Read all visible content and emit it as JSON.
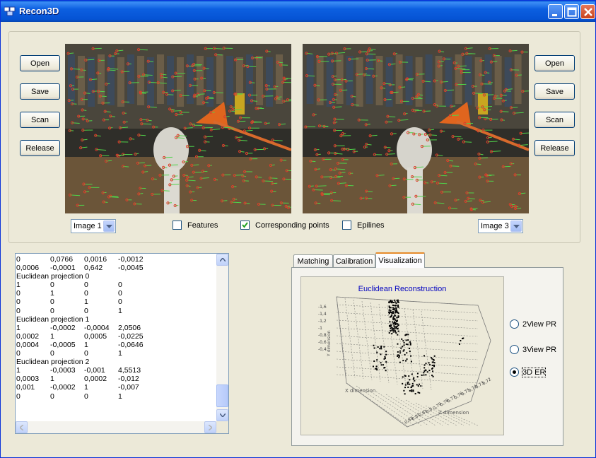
{
  "window": {
    "title": "Recon3D"
  },
  "left_buttons": [
    "Open",
    "Save",
    "Scan",
    "Release"
  ],
  "right_buttons": [
    "Open",
    "Save",
    "Scan",
    "Release"
  ],
  "left_image": {
    "alt": "Image 1",
    "selected": "Image 1"
  },
  "right_image": {
    "alt": "Image 3",
    "selected": "Image 3"
  },
  "checkboxes": [
    {
      "label": "Features",
      "checked": false
    },
    {
      "label": "Corresponding points",
      "checked": true
    },
    {
      "label": "Epilines",
      "checked": false
    }
  ],
  "output_lines": [
    [
      "0",
      "0,0766",
      "0,0016",
      "-0,0012"
    ],
    [
      "0,0006",
      "-0,0001",
      "0,642",
      "-0,0045"
    ],
    [
      "Euclidean projection 0"
    ],
    [
      "1",
      "0",
      "0",
      "0"
    ],
    [
      "0",
      "1",
      "0",
      "0"
    ],
    [
      "0",
      "0",
      "1",
      "0"
    ],
    [
      "0",
      "0",
      "0",
      "1"
    ],
    [
      "Euclidean projection 1"
    ],
    [
      "1",
      "-0,0002",
      "-0,0004",
      "2,0506"
    ],
    [
      "0,0002",
      "1",
      "0,0005",
      "-0,0225"
    ],
    [
      "0,0004",
      "-0,0005",
      "1",
      "-0,0646"
    ],
    [
      "0",
      "0",
      "0",
      "1"
    ],
    [
      "Euclidean projection 2"
    ],
    [
      "1",
      "-0,0003",
      "-0,001",
      "4,5513"
    ],
    [
      "0,0003",
      "1",
      "0,0002",
      "-0,012"
    ],
    [
      "0,001",
      "-0,0002",
      "1",
      "-0,007"
    ],
    [
      "0",
      "0",
      "0",
      "1"
    ]
  ],
  "tabs": [
    "Matching",
    "Calibration",
    "Visualization"
  ],
  "active_tab": "Visualization",
  "plot": {
    "title": "Euclidean Reconstruction",
    "x_axis_label": "X dimension",
    "y_axis_label": "Y dimension",
    "z_axis_label": "Z dimension",
    "y_ticks": [
      "-1,6",
      "-1,4",
      "-1,2",
      "-1",
      "-0,8",
      "-0,6",
      "-0,4"
    ],
    "z_ticks": [
      "0,83",
      "0,82",
      "0,81",
      "0,8",
      "0,79",
      "0,78",
      "0,77",
      "0,76",
      "0,75",
      "0,74",
      "0,73",
      "0,72"
    ]
  },
  "radios": [
    {
      "label": "2View PR",
      "selected": false
    },
    {
      "label": "3View PR",
      "selected": false
    },
    {
      "label": "3D ER",
      "selected": true
    }
  ],
  "colors": {
    "title_blue": "#0054e3",
    "close_red": "#d2502a",
    "match_green": "#4fd34a",
    "match_red": "#e03a2a",
    "plot_title": "#0000c0"
  }
}
